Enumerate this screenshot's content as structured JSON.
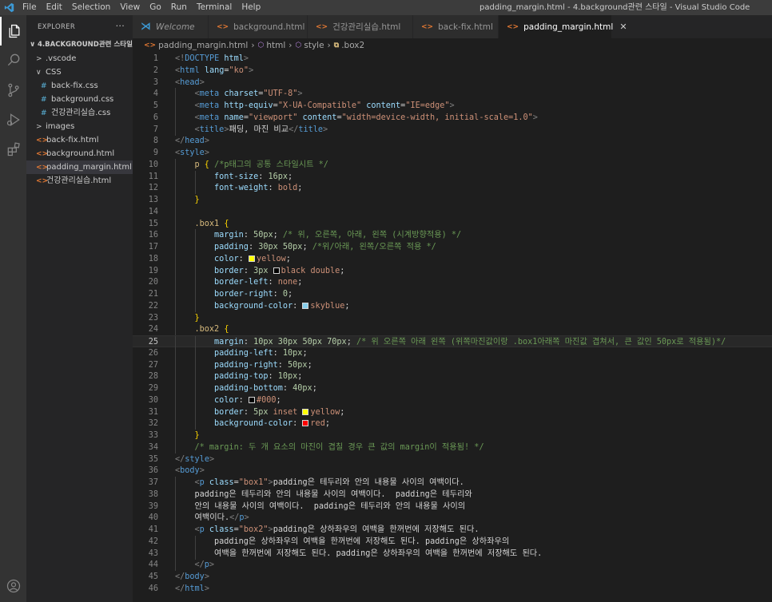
{
  "window": {
    "title": "padding_margin.html - 4.background관련 스타일 - Visual Studio Code",
    "menu": [
      "File",
      "Edit",
      "Selection",
      "View",
      "Go",
      "Run",
      "Terminal",
      "Help"
    ]
  },
  "sidebar": {
    "header": "EXPLORER",
    "more": "···",
    "items": [
      {
        "label": "4.BACKGROUND관련 스타일",
        "indent": 0,
        "chevron": "∨",
        "type": "root"
      },
      {
        "label": ".vscode",
        "indent": 1,
        "chevron": ">",
        "type": "folder"
      },
      {
        "label": "CSS",
        "indent": 1,
        "chevron": "∨",
        "type": "folder"
      },
      {
        "label": "back-fix.css",
        "indent": 2,
        "type": "css"
      },
      {
        "label": "background.css",
        "indent": 2,
        "type": "css"
      },
      {
        "label": "건강관리실습.css",
        "indent": 2,
        "type": "css"
      },
      {
        "label": "images",
        "indent": 1,
        "chevron": ">",
        "type": "folder"
      },
      {
        "label": "back-fix.html",
        "indent": 1,
        "type": "html"
      },
      {
        "label": "background.html",
        "indent": 1,
        "type": "html"
      },
      {
        "label": "padding_margin.html",
        "indent": 1,
        "type": "html",
        "selected": true
      },
      {
        "label": "건강관리실습.html",
        "indent": 1,
        "type": "html"
      }
    ]
  },
  "tabs": [
    {
      "label": "Welcome",
      "icon": "vscode",
      "italic": true
    },
    {
      "label": "background.html",
      "icon": "html"
    },
    {
      "label": "건강관리실습.html",
      "icon": "html"
    },
    {
      "label": "back-fix.html",
      "icon": "html"
    },
    {
      "label": "padding_margin.html",
      "icon": "html",
      "active": true,
      "close": "✕"
    }
  ],
  "breadcrumb": [
    "padding_margin.html",
    "html",
    "style",
    ".box2"
  ],
  "editor": {
    "current_line": 25,
    "lines": [
      {
        "n": 1,
        "i": 0,
        "t": [
          [
            "t-pun",
            "<!"
          ],
          [
            "t-tag",
            "DOCTYPE"
          ],
          [
            "t-txt",
            " "
          ],
          [
            "t-attr",
            "html"
          ],
          [
            "t-pun",
            ">"
          ]
        ]
      },
      {
        "n": 2,
        "i": 0,
        "t": [
          [
            "t-pun",
            "<"
          ],
          [
            "t-tag",
            "html"
          ],
          [
            "t-txt",
            " "
          ],
          [
            "t-attr",
            "lang"
          ],
          [
            "t-txt",
            "="
          ],
          [
            "t-str",
            "\"ko\""
          ],
          [
            "t-pun",
            ">"
          ]
        ]
      },
      {
        "n": 3,
        "i": 0,
        "t": [
          [
            "t-pun",
            "<"
          ],
          [
            "t-tag",
            "head"
          ],
          [
            "t-pun",
            ">"
          ]
        ]
      },
      {
        "n": 4,
        "i": 1,
        "t": [
          [
            "t-pun",
            "<"
          ],
          [
            "t-tag",
            "meta"
          ],
          [
            "t-txt",
            " "
          ],
          [
            "t-attr",
            "charset"
          ],
          [
            "t-txt",
            "="
          ],
          [
            "t-str",
            "\"UTF-8\""
          ],
          [
            "t-pun",
            ">"
          ]
        ]
      },
      {
        "n": 5,
        "i": 1,
        "t": [
          [
            "t-pun",
            "<"
          ],
          [
            "t-tag",
            "meta"
          ],
          [
            "t-txt",
            " "
          ],
          [
            "t-attr",
            "http-equiv"
          ],
          [
            "t-txt",
            "="
          ],
          [
            "t-str",
            "\"X-UA-Compatible\""
          ],
          [
            "t-txt",
            " "
          ],
          [
            "t-attr",
            "content"
          ],
          [
            "t-txt",
            "="
          ],
          [
            "t-str",
            "\"IE=edge\""
          ],
          [
            "t-pun",
            ">"
          ]
        ]
      },
      {
        "n": 6,
        "i": 1,
        "t": [
          [
            "t-pun",
            "<"
          ],
          [
            "t-tag",
            "meta"
          ],
          [
            "t-txt",
            " "
          ],
          [
            "t-attr",
            "name"
          ],
          [
            "t-txt",
            "="
          ],
          [
            "t-str",
            "\"viewport\""
          ],
          [
            "t-txt",
            " "
          ],
          [
            "t-attr",
            "content"
          ],
          [
            "t-txt",
            "="
          ],
          [
            "t-str",
            "\"width=device-width, initial-scale=1.0\""
          ],
          [
            "t-pun",
            ">"
          ]
        ]
      },
      {
        "n": 7,
        "i": 1,
        "t": [
          [
            "t-pun",
            "<"
          ],
          [
            "t-tag",
            "title"
          ],
          [
            "t-pun",
            ">"
          ],
          [
            "t-txt",
            "패딩, 마진 비교"
          ],
          [
            "t-pun",
            "</"
          ],
          [
            "t-tag",
            "title"
          ],
          [
            "t-pun",
            ">"
          ]
        ]
      },
      {
        "n": 8,
        "i": 0,
        "t": [
          [
            "t-pun",
            "</"
          ],
          [
            "t-tag",
            "head"
          ],
          [
            "t-pun",
            ">"
          ]
        ]
      },
      {
        "n": 9,
        "i": 0,
        "t": [
          [
            "t-pun",
            "<"
          ],
          [
            "t-tag",
            "style"
          ],
          [
            "t-pun",
            ">"
          ]
        ]
      },
      {
        "n": 10,
        "i": 1,
        "t": [
          [
            "t-sel",
            "p"
          ],
          [
            "t-txt",
            " "
          ],
          [
            "t-brc",
            "{"
          ],
          [
            "t-txt",
            " "
          ],
          [
            "t-com",
            "/*p태그의 공통 스타일시트 */"
          ]
        ]
      },
      {
        "n": 11,
        "i": 2,
        "t": [
          [
            "t-prop",
            "font-size"
          ],
          [
            "t-txt",
            ": "
          ],
          [
            "t-num",
            "16px"
          ],
          [
            "t-txt",
            ";"
          ]
        ]
      },
      {
        "n": 12,
        "i": 2,
        "t": [
          [
            "t-prop",
            "font-weight"
          ],
          [
            "t-txt",
            ": "
          ],
          [
            "t-val",
            "bold"
          ],
          [
            "t-txt",
            ";"
          ]
        ]
      },
      {
        "n": 13,
        "i": 1,
        "t": [
          [
            "t-brc",
            "}"
          ]
        ]
      },
      {
        "n": 14,
        "i": 1,
        "t": []
      },
      {
        "n": 15,
        "i": 1,
        "t": [
          [
            "t-sel",
            ".box1"
          ],
          [
            "t-txt",
            " "
          ],
          [
            "t-brc",
            "{"
          ]
        ]
      },
      {
        "n": 16,
        "i": 2,
        "t": [
          [
            "t-prop",
            "margin"
          ],
          [
            "t-txt",
            ": "
          ],
          [
            "t-num",
            "50px"
          ],
          [
            "t-txt",
            "; "
          ],
          [
            "t-com",
            "/* 위, 오른쪽, 아래, 왼쪽 (시계방향적용) */"
          ]
        ]
      },
      {
        "n": 17,
        "i": 2,
        "t": [
          [
            "t-prop",
            "padding"
          ],
          [
            "t-txt",
            ": "
          ],
          [
            "t-num",
            "30px"
          ],
          [
            "t-txt",
            " "
          ],
          [
            "t-num",
            "50px"
          ],
          [
            "t-txt",
            "; "
          ],
          [
            "t-com",
            "/*위/아래, 왼쪽/오른쪽 적용 */"
          ]
        ]
      },
      {
        "n": 18,
        "i": 2,
        "t": [
          [
            "t-prop",
            "color"
          ],
          [
            "t-txt",
            ": "
          ],
          [
            "sw",
            "#ffff00"
          ],
          [
            "t-val",
            "yellow"
          ],
          [
            "t-txt",
            ";"
          ]
        ]
      },
      {
        "n": 19,
        "i": 2,
        "t": [
          [
            "t-prop",
            "border"
          ],
          [
            "t-txt",
            ": "
          ],
          [
            "t-num",
            "3px"
          ],
          [
            "t-txt",
            " "
          ],
          [
            "sw",
            "#000000"
          ],
          [
            "t-val",
            "black double"
          ],
          [
            "t-txt",
            ";"
          ]
        ]
      },
      {
        "n": 20,
        "i": 2,
        "t": [
          [
            "t-prop",
            "border-left"
          ],
          [
            "t-txt",
            ": "
          ],
          [
            "t-val",
            "none"
          ],
          [
            "t-txt",
            ";"
          ]
        ]
      },
      {
        "n": 21,
        "i": 2,
        "t": [
          [
            "t-prop",
            "border-right"
          ],
          [
            "t-txt",
            ": "
          ],
          [
            "t-num",
            "0"
          ],
          [
            "t-txt",
            ";"
          ]
        ]
      },
      {
        "n": 22,
        "i": 2,
        "t": [
          [
            "t-prop",
            "background-color"
          ],
          [
            "t-txt",
            ": "
          ],
          [
            "sw",
            "#87ceeb"
          ],
          [
            "t-val",
            "skyblue"
          ],
          [
            "t-txt",
            ";"
          ]
        ]
      },
      {
        "n": 23,
        "i": 1,
        "t": [
          [
            "t-brc",
            "}"
          ]
        ]
      },
      {
        "n": 24,
        "i": 1,
        "t": [
          [
            "t-sel",
            ".box2"
          ],
          [
            "t-txt",
            " "
          ],
          [
            "t-brc",
            "{"
          ]
        ]
      },
      {
        "n": 25,
        "i": 2,
        "t": [
          [
            "t-prop",
            "margin"
          ],
          [
            "t-txt",
            ": "
          ],
          [
            "t-num",
            "10px"
          ],
          [
            "t-txt",
            " "
          ],
          [
            "t-num",
            "30px"
          ],
          [
            "t-txt",
            " "
          ],
          [
            "t-num",
            "50px"
          ],
          [
            "t-txt",
            " "
          ],
          [
            "t-num",
            "70px"
          ],
          [
            "t-txt",
            "; "
          ],
          [
            "t-com",
            "/* 위 오른쪽 아래 왼쪽 (위쪽마진값이랑 .box1아래쪽 마진값 겹쳐서, 큰 값인 50px로 적용됨)*/"
          ]
        ]
      },
      {
        "n": 26,
        "i": 2,
        "t": [
          [
            "t-prop",
            "padding-left"
          ],
          [
            "t-txt",
            ": "
          ],
          [
            "t-num",
            "10px"
          ],
          [
            "t-txt",
            ";"
          ]
        ]
      },
      {
        "n": 27,
        "i": 2,
        "t": [
          [
            "t-prop",
            "padding-right"
          ],
          [
            "t-txt",
            ": "
          ],
          [
            "t-num",
            "50px"
          ],
          [
            "t-txt",
            ";"
          ]
        ]
      },
      {
        "n": 28,
        "i": 2,
        "t": [
          [
            "t-prop",
            "padding-top"
          ],
          [
            "t-txt",
            ": "
          ],
          [
            "t-num",
            "10px"
          ],
          [
            "t-txt",
            ";"
          ]
        ]
      },
      {
        "n": 29,
        "i": 2,
        "t": [
          [
            "t-prop",
            "padding-bottom"
          ],
          [
            "t-txt",
            ": "
          ],
          [
            "t-num",
            "40px"
          ],
          [
            "t-txt",
            ";"
          ]
        ]
      },
      {
        "n": 30,
        "i": 2,
        "t": [
          [
            "t-prop",
            "color"
          ],
          [
            "t-txt",
            ": "
          ],
          [
            "sw",
            "#000000"
          ],
          [
            "t-val",
            "#000"
          ],
          [
            "t-txt",
            ";"
          ]
        ]
      },
      {
        "n": 31,
        "i": 2,
        "t": [
          [
            "t-prop",
            "border"
          ],
          [
            "t-txt",
            ": "
          ],
          [
            "t-num",
            "5px"
          ],
          [
            "t-txt",
            " "
          ],
          [
            "t-val",
            "inset"
          ],
          [
            "t-txt",
            " "
          ],
          [
            "sw",
            "#ffff00"
          ],
          [
            "t-val",
            "yellow"
          ],
          [
            "t-txt",
            ";"
          ]
        ]
      },
      {
        "n": 32,
        "i": 2,
        "t": [
          [
            "t-prop",
            "background-color"
          ],
          [
            "t-txt",
            ": "
          ],
          [
            "sw",
            "#ff0000"
          ],
          [
            "t-val",
            "red"
          ],
          [
            "t-txt",
            ";"
          ]
        ]
      },
      {
        "n": 33,
        "i": 1,
        "t": [
          [
            "t-brc",
            "}"
          ]
        ]
      },
      {
        "n": 34,
        "i": 1,
        "t": [
          [
            "t-com",
            "/* margin: 두 개 요소의 마진이 겹칠 경우 큰 값의 margin이 적용됨! */"
          ]
        ]
      },
      {
        "n": 35,
        "i": 0,
        "t": [
          [
            "t-pun",
            "</"
          ],
          [
            "t-tag",
            "style"
          ],
          [
            "t-pun",
            ">"
          ]
        ]
      },
      {
        "n": 36,
        "i": 0,
        "t": [
          [
            "t-pun",
            "<"
          ],
          [
            "t-tag",
            "body"
          ],
          [
            "t-pun",
            ">"
          ]
        ]
      },
      {
        "n": 37,
        "i": 1,
        "t": [
          [
            "t-pun",
            "<"
          ],
          [
            "t-tag",
            "p"
          ],
          [
            "t-txt",
            " "
          ],
          [
            "t-attr",
            "class"
          ],
          [
            "t-txt",
            "="
          ],
          [
            "t-str",
            "\"box1\""
          ],
          [
            "t-pun",
            ">"
          ],
          [
            "t-txt",
            "padding은 테두리와 안의 내용물 사이의 여백이다."
          ]
        ]
      },
      {
        "n": 38,
        "i": 1,
        "t": [
          [
            "t-txt",
            "padding은 테두리와 안의 내용물 사이의 여백이다.  padding은 테두리와"
          ]
        ]
      },
      {
        "n": 39,
        "i": 1,
        "t": [
          [
            "t-txt",
            "안의 내용물 사이의 여백이다.  padding은 테두리와 안의 내용물 사이의"
          ]
        ]
      },
      {
        "n": 40,
        "i": 1,
        "t": [
          [
            "t-txt",
            "여백이다."
          ],
          [
            "t-pun",
            "</"
          ],
          [
            "t-tag",
            "p"
          ],
          [
            "t-pun",
            ">"
          ]
        ]
      },
      {
        "n": 41,
        "i": 1,
        "t": [
          [
            "t-pun",
            "<"
          ],
          [
            "t-tag",
            "p"
          ],
          [
            "t-txt",
            " "
          ],
          [
            "t-attr",
            "class"
          ],
          [
            "t-txt",
            "="
          ],
          [
            "t-str",
            "\"box2\""
          ],
          [
            "t-pun",
            ">"
          ],
          [
            "t-txt",
            "padding은 상하좌우의 여백을 한꺼번에 저장해도 된다."
          ]
        ]
      },
      {
        "n": 42,
        "i": 2,
        "t": [
          [
            "t-txt",
            "padding은 상하좌우의 여백을 한꺼번에 저장해도 된다. padding은 상하좌우의"
          ]
        ]
      },
      {
        "n": 43,
        "i": 2,
        "t": [
          [
            "t-txt",
            "여백을 한꺼번에 저장해도 된다. padding은 상하좌우의 여백을 한꺼번에 저장해도 된다."
          ]
        ]
      },
      {
        "n": 44,
        "i": 1,
        "t": [
          [
            "t-pun",
            "</"
          ],
          [
            "t-tag",
            "p"
          ],
          [
            "t-pun",
            ">"
          ]
        ]
      },
      {
        "n": 45,
        "i": 0,
        "t": [
          [
            "t-pun",
            "</"
          ],
          [
            "t-tag",
            "body"
          ],
          [
            "t-pun",
            ">"
          ]
        ]
      },
      {
        "n": 46,
        "i": 0,
        "t": [
          [
            "t-pun",
            "</"
          ],
          [
            "t-tag",
            "html"
          ],
          [
            "t-pun",
            ">"
          ]
        ]
      }
    ]
  }
}
